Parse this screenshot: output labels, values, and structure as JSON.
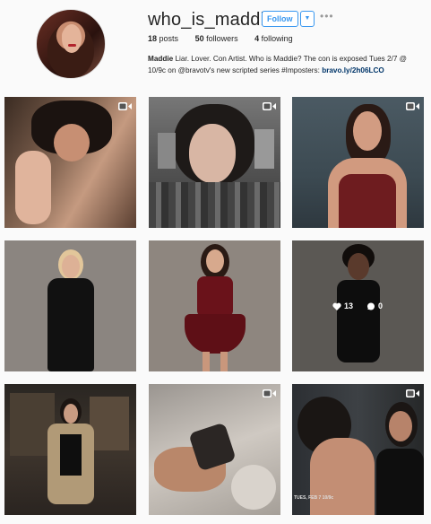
{
  "profile": {
    "username": "who_is_maddie",
    "follow_label": "Follow",
    "caret_icon": "chevron-down-icon",
    "more_icon": "more-options-icon",
    "stats": {
      "posts_count": "18",
      "posts_label": "posts",
      "followers_count": "50",
      "followers_label": "followers",
      "following_count": "4",
      "following_label": "following"
    },
    "bio": {
      "name": "Maddie",
      "text": " Liar. Lover. Con Artist. Who is Maddie? The con is exposed Tues 2/7 @ 10/9c on @bravotv's new scripted series #Imposters: ",
      "link": "bravo.ly/2h06LCO"
    },
    "accent_color": "#3897f0"
  },
  "posts": [
    {
      "type": "video",
      "icon": "video-camera-icon"
    },
    {
      "type": "video",
      "icon": "video-camera-icon"
    },
    {
      "type": "video",
      "icon": "video-camera-icon"
    },
    {
      "type": "image"
    },
    {
      "type": "image"
    },
    {
      "type": "image",
      "hover": {
        "likes": "13",
        "comments": "0",
        "like_icon": "heart-icon",
        "comment_icon": "comment-icon"
      }
    },
    {
      "type": "image"
    },
    {
      "type": "video",
      "icon": "video-camera-icon"
    },
    {
      "type": "video",
      "icon": "video-camera-icon",
      "caption_overlay": "TUES, FEB 7 10/9c"
    }
  ]
}
